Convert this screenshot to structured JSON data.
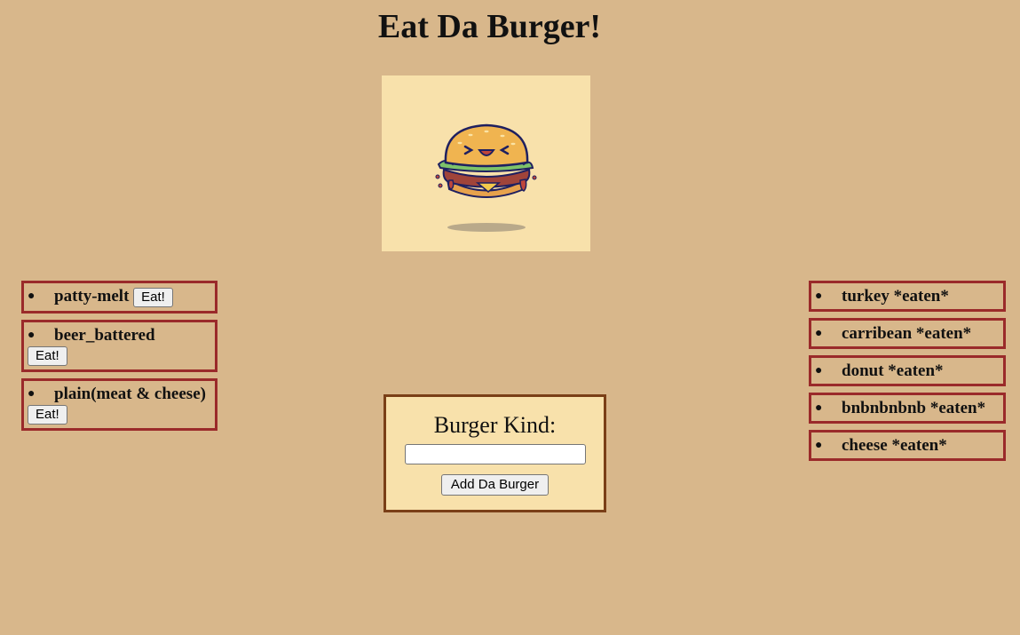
{
  "header": {
    "title": "Eat Da Burger!"
  },
  "image": {
    "alt": "burger-icon"
  },
  "uneaten": {
    "items": [
      {
        "name": "patty-melt",
        "button": "Eat!"
      },
      {
        "name": "beer_battered",
        "button": "Eat!"
      },
      {
        "name": "plain(meat & cheese)",
        "button": "Eat!"
      }
    ]
  },
  "eaten": {
    "items": [
      {
        "name": "turkey *eaten*"
      },
      {
        "name": "carribean *eaten*"
      },
      {
        "name": "donut *eaten*"
      },
      {
        "name": "bnbnbnbnb *eaten*"
      },
      {
        "name": "cheese *eaten*"
      }
    ]
  },
  "form": {
    "label": "Burger Kind:",
    "input_value": "",
    "input_placeholder": "",
    "submit_label": "Add Da Burger"
  },
  "colors": {
    "background": "#d8b78b",
    "card_border": "#9a2a2a",
    "form_bg": "#f8e1ab",
    "form_border": "#7a3f17"
  }
}
